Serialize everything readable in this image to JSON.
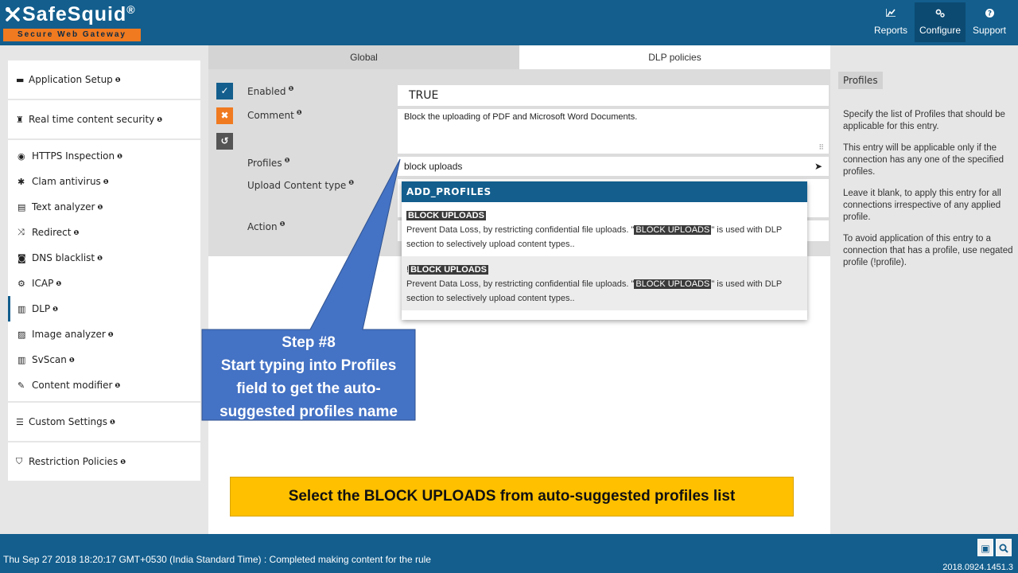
{
  "header": {
    "logo_text": "SafeSquid",
    "logo_reg": "®",
    "logo_tagline": "Secure Web Gateway",
    "nav": [
      {
        "label": "Reports",
        "icon": "chart-icon"
      },
      {
        "label": "Configure",
        "icon": "cogs-icon"
      },
      {
        "label": "Support",
        "icon": "question-icon"
      }
    ]
  },
  "sidebar": {
    "sections": [
      {
        "label": "Application Setup",
        "icon": "briefcase-icon"
      },
      {
        "label": "Real time content security",
        "icon": "tower-icon"
      },
      {
        "label": "Custom Settings",
        "icon": "sliders-icon"
      },
      {
        "label": "Restriction Policies",
        "icon": "shield-icon"
      }
    ],
    "items": [
      {
        "label": "HTTPS Inspection",
        "icon": "eye-icon"
      },
      {
        "label": "Clam antivirus",
        "icon": "asterisk-icon"
      },
      {
        "label": "Text analyzer",
        "icon": "document-icon"
      },
      {
        "label": "Redirect",
        "icon": "shuffle-icon"
      },
      {
        "label": "DNS blacklist",
        "icon": "blacklist-icon"
      },
      {
        "label": "ICAP",
        "icon": "gear-icon"
      },
      {
        "label": "DLP",
        "icon": "barcode-icon"
      },
      {
        "label": "Image analyzer",
        "icon": "image-icon"
      },
      {
        "label": "SvScan",
        "icon": "barcode-icon"
      },
      {
        "label": "Content modifier",
        "icon": "edit-icon"
      }
    ],
    "info_glyph": "❶"
  },
  "tabs": {
    "global": "Global",
    "dlp": "DLP policies"
  },
  "form": {
    "enabled_label": "Enabled",
    "enabled_value": "TRUE",
    "comment_label": "Comment",
    "comment_value": "Block the uploading of PDF and Microsoft Word Documents.",
    "profiles_label": "Profiles",
    "profiles_value": "block uploads",
    "upload_label": "Upload Content type",
    "action_label": "Action"
  },
  "dropdown": {
    "header": "ADD_PROFILES",
    "options": [
      {
        "name": "BLOCK UPLOADS",
        "prefix": "",
        "desc_a": "Prevent Data Loss, by restricting confidential file uploads. \"",
        "desc_hl": "BLOCK UPLOADS",
        "desc_b": "\" is used with DLP section to selectively upload content types.."
      },
      {
        "name": "BLOCK UPLOADS",
        "prefix": "!",
        "desc_a": "Prevent Data Loss, by restricting confidential file uploads. \"",
        "desc_hl": "BLOCK UPLOADS",
        "desc_b": "\" is used with DLP section to selectively upload content types.."
      }
    ]
  },
  "right_panel": {
    "tag": "Profiles",
    "paragraphs": [
      "Specify the list of Profiles that should be applicable for this entry.",
      "This entry will be applicable only if the connection has any one of the specified profiles.",
      "Leave it blank, to apply this entry for all connections irrespective of any applied profile.",
      "To avoid application of this entry to a connection that has a profile, use negated profile (!profile)."
    ]
  },
  "callout": {
    "lines": [
      "Step #8",
      "Start typing into Profiles",
      "field to get the auto-",
      "suggested profiles name"
    ],
    "color": "#4472c4"
  },
  "banner": {
    "text": "Select the BLOCK UPLOADS from auto-suggested profiles list",
    "color": "#ffc000"
  },
  "footer": {
    "status": "Thu Sep 27 2018 18:20:17 GMT+0530 (India Standard Time) : Completed making content for the rule",
    "version": "2018.0924.1451.3"
  },
  "colors": {
    "brand": "#135e8d",
    "accent": "#f07a20"
  }
}
